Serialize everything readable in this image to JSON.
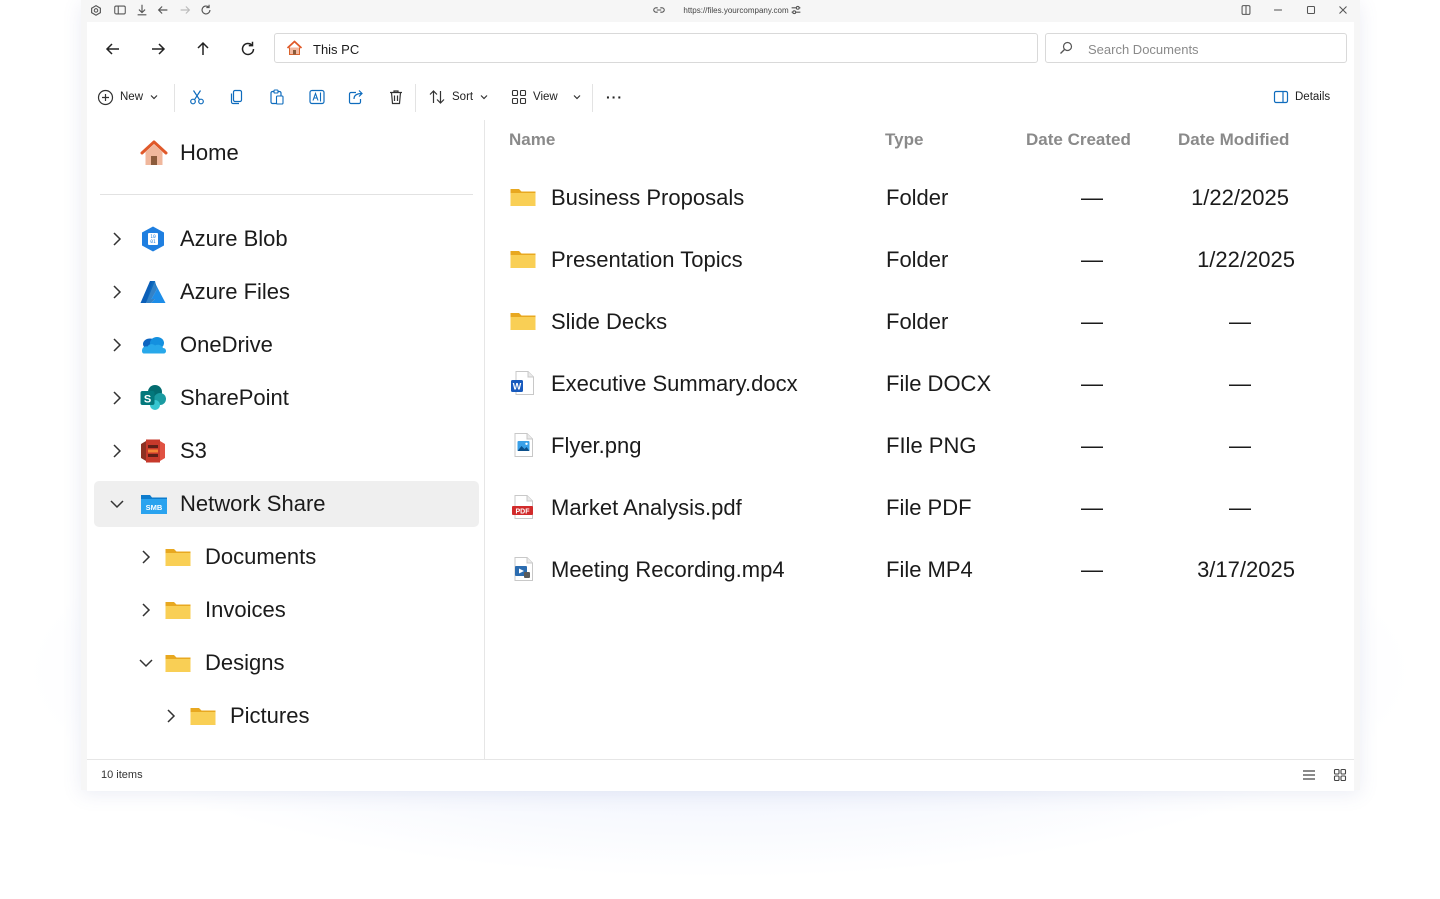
{
  "browser": {
    "url": "https://files.yourcompany.com"
  },
  "nav": {
    "address": "This PC",
    "search_placeholder": "Search Documents"
  },
  "toolbar": {
    "new_label": "New",
    "sort_label": "Sort",
    "view_label": "View",
    "more_label": "···",
    "details_label": "Details"
  },
  "sidebar": {
    "home": "Home",
    "items": [
      {
        "label": "Azure Blob",
        "icon": "azure-blob-icon",
        "expanded": false
      },
      {
        "label": "Azure Files",
        "icon": "azure-files-icon",
        "expanded": false
      },
      {
        "label": "OneDrive",
        "icon": "onedrive-icon",
        "expanded": false
      },
      {
        "label": "SharePoint",
        "icon": "sharepoint-icon",
        "expanded": false
      },
      {
        "label": "S3",
        "icon": "s3-icon",
        "expanded": false
      },
      {
        "label": "Network Share",
        "icon": "smb-icon",
        "expanded": true,
        "selected": true,
        "icon_text": "SMB"
      }
    ],
    "children": [
      {
        "label": "Documents",
        "expanded": false
      },
      {
        "label": "Invoices",
        "expanded": false
      },
      {
        "label": "Designs",
        "expanded": true
      },
      {
        "label": "Pictures",
        "expanded": false
      }
    ]
  },
  "columns": {
    "name": "Name",
    "type": "Type",
    "created": "Date Created",
    "modified": "Date Modified"
  },
  "files": [
    {
      "name": "Business Proposals",
      "type": "Folder",
      "created": "—",
      "modified": "1/22/2025",
      "icon": "folder-icon"
    },
    {
      "name": "Presentation Topics",
      "type": "Folder",
      "created": "—",
      "modified": "1/22/2025",
      "icon": "folder-icon"
    },
    {
      "name": "Slide Decks",
      "type": "Folder",
      "created": "—",
      "modified": "—",
      "icon": "folder-icon"
    },
    {
      "name": "Executive Summary.docx",
      "type": "File DOCX",
      "created": "—",
      "modified": "—",
      "icon": "word-doc-icon"
    },
    {
      "name": "Flyer.png",
      "type": "FIle PNG",
      "created": "—",
      "modified": "—",
      "icon": "image-file-icon"
    },
    {
      "name": "Market Analysis.pdf",
      "type": "File PDF",
      "created": "—",
      "modified": "—",
      "icon": "pdf-file-icon",
      "icon_text": "PDF"
    },
    {
      "name": "Meeting Recording.mp4",
      "type": "File MP4",
      "created": "—",
      "modified": "3/17/2025",
      "icon": "video-file-icon"
    }
  ],
  "status": {
    "count": "10 items"
  },
  "colors": {
    "accent": "#0f6cbd",
    "folder": "#f7c948",
    "header_text": "#8a8a8a",
    "selected_bg": "#efefef"
  }
}
